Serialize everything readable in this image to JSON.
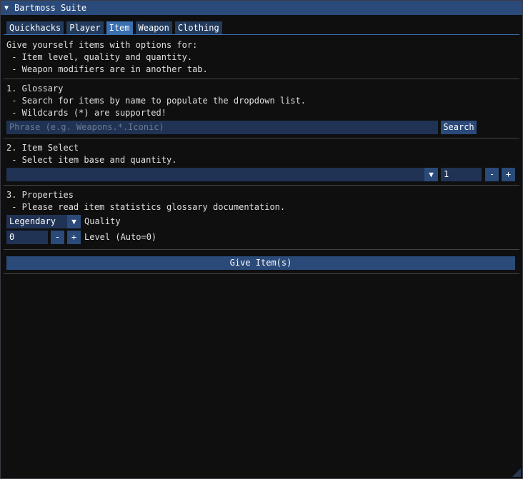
{
  "window": {
    "title": "Bartmoss Suite",
    "collapse_icon": "triangle-down-icon"
  },
  "tabs": [
    {
      "label": "Quickhacks",
      "active": false
    },
    {
      "label": "Player",
      "active": false
    },
    {
      "label": "Item",
      "active": true
    },
    {
      "label": "Weapon",
      "active": false
    },
    {
      "label": "Clothing",
      "active": false
    }
  ],
  "intro": {
    "line1": "Give yourself items with options for:",
    "line2": " - Item level, quality and quantity.",
    "line3": " - Weapon modifiers are in another tab."
  },
  "glossary": {
    "heading": "1. Glossary",
    "line1": " - Search for items by name to populate the dropdown list.",
    "line2": " - Wildcards (*) are supported!",
    "placeholder": "Phrase (e.g. Weapons.*.Iconic)",
    "search_label": "Search"
  },
  "item_select": {
    "heading": "2. Item Select",
    "line1": " - Select item base and quantity.",
    "selected": "",
    "quantity": "1",
    "minus": "-",
    "plus": "+"
  },
  "properties": {
    "heading": "3. Properties",
    "line1": " - Please read item statistics glossary documentation.",
    "quality_value": "Legendary",
    "quality_label": "Quality",
    "level_value": "0",
    "minus": "-",
    "plus": "+",
    "level_label": "Level (Auto=0)"
  },
  "give_button": "Give Item(s)",
  "colors": {
    "title_bar": "#2a4a7a",
    "tab_active": "#3a6fb0",
    "tab": "#223a5c",
    "field_bg": "#203354",
    "window_bg": "#0f0f10"
  }
}
